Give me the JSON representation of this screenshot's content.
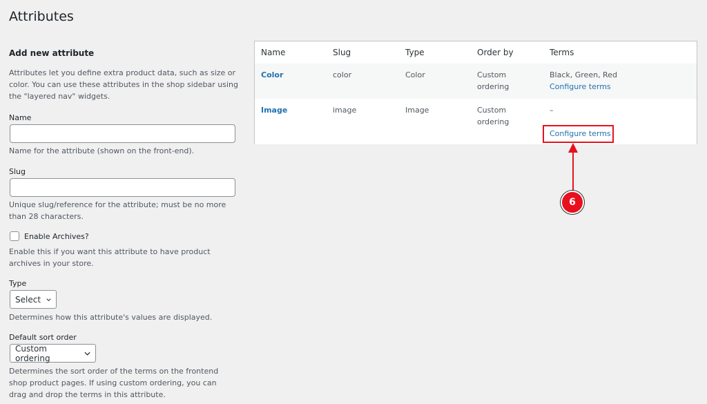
{
  "page": {
    "title": "Attributes"
  },
  "form": {
    "heading": "Add new attribute",
    "intro": "Attributes let you define extra product data, such as size or color. You can use these attributes in the shop sidebar using the \"layered nav\" widgets.",
    "name": {
      "label": "Name",
      "value": "",
      "help": "Name for the attribute (shown on the front-end)."
    },
    "slug": {
      "label": "Slug",
      "value": "",
      "help": "Unique slug/reference for the attribute; must be no more than 28 characters."
    },
    "archives": {
      "label": "Enable Archives?",
      "checked": false,
      "help": "Enable this if you want this attribute to have product archives in your store."
    },
    "type": {
      "label": "Type",
      "value": "Select",
      "help": "Determines how this attribute's values are displayed."
    },
    "sort": {
      "label": "Default sort order",
      "value": "Custom ordering",
      "help": "Determines the sort order of the terms on the frontend shop product pages. If using custom ordering, you can drag and drop the terms in this attribute."
    }
  },
  "table": {
    "headers": {
      "name": "Name",
      "slug": "Slug",
      "type": "Type",
      "order": "Order by",
      "terms": "Terms"
    },
    "rows": [
      {
        "name": "Color",
        "slug": "color",
        "type": "Color",
        "order_line1": "Custom",
        "order_line2": "ordering",
        "terms": "Black, Green, Red",
        "configure": "Configure terms"
      },
      {
        "name": "Image",
        "slug": "image",
        "type": "Image",
        "order_line1": "Custom",
        "order_line2": "ordering",
        "terms": "–",
        "configure": "Configure terms"
      }
    ]
  },
  "annotation": {
    "step": "6",
    "color": "#e8101e"
  },
  "colors": {
    "link": "#2271b1",
    "background": "#f0f0f1"
  }
}
